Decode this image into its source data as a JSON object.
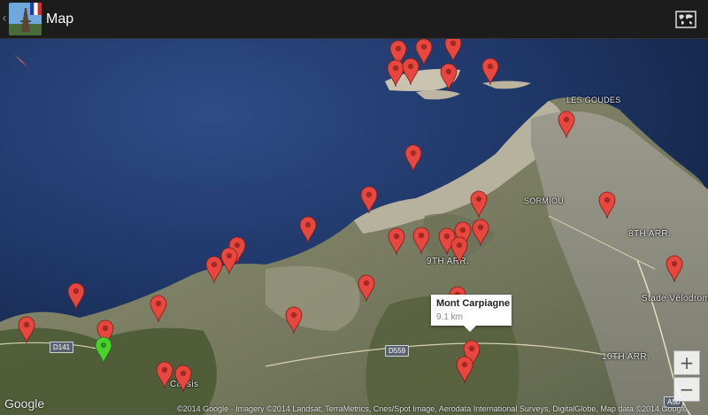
{
  "actionbar": {
    "up_caret": "‹",
    "title": "Map",
    "app_icon": "eiffel-tower-flag-icon",
    "map_type_icon": "world-map-icon"
  },
  "map": {
    "place_labels": [
      "LES GOUDES",
      "SORMIOU",
      "8TH ARR.",
      "9TH ARR.",
      "Stade Vélodrome",
      "10TH ARR.",
      "Cassis"
    ],
    "road_labels": [
      "D141",
      "D559",
      "A50"
    ],
    "info_window": {
      "title": "Mont Carpiagne",
      "distance": "9.1 km"
    },
    "marker_colors": {
      "poi": "#e8473f",
      "current": "#4bd12f"
    },
    "zoom_in": "+",
    "zoom_out": "−",
    "google_logo": "Google",
    "attribution": "©2014 Google · Imagery ©2014 Landsat, TerraMetrics, Cnes/Spot Image, Aerodata International Surveys, DigitalGlobe, Map data ©2014 Google"
  }
}
